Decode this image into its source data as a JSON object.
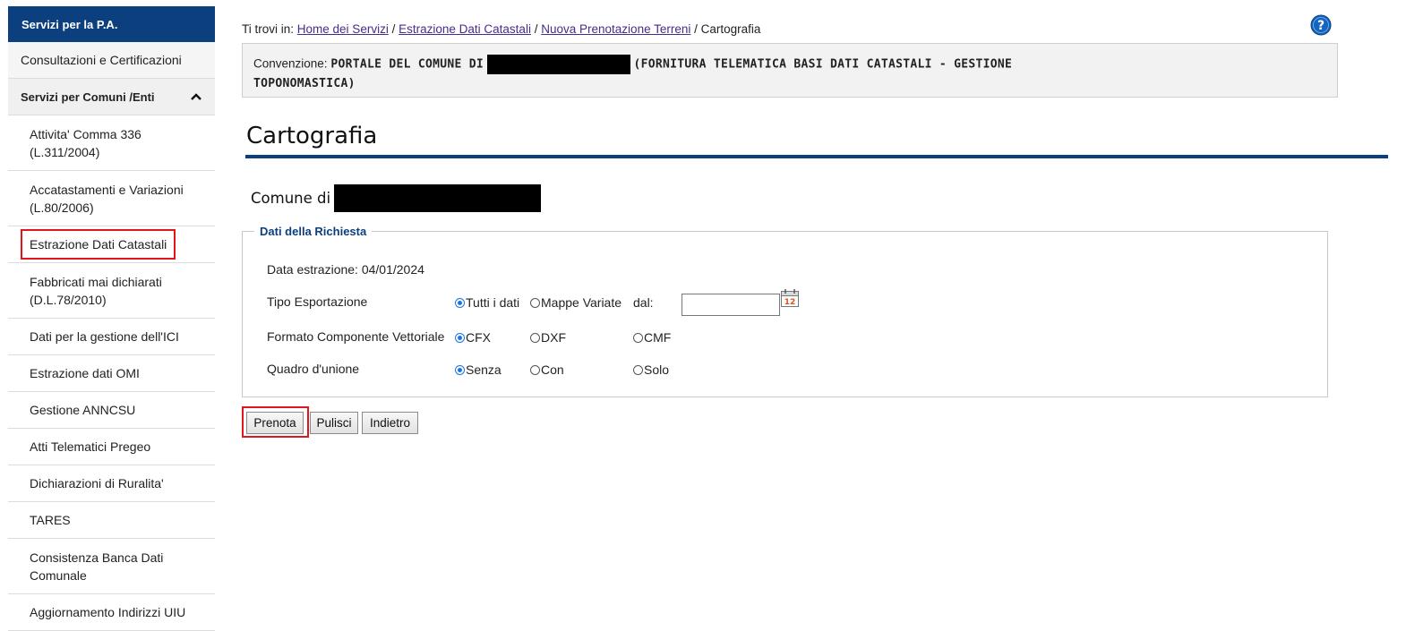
{
  "sidebar": {
    "header": "Servizi per la P.A.",
    "level1_consultazioni": "Consultazioni e Certificazioni",
    "level1_comuni": "Servizi per Comuni /Enti",
    "items": [
      {
        "line1": "Attivita' Comma 336",
        "line2": "(L.311/2004)"
      },
      {
        "line1": "Accatastamenti e Variazioni",
        "line2": "(L.80/2006)"
      },
      {
        "line1": "Estrazione Dati Catastali",
        "line2": ""
      },
      {
        "line1": "Fabbricati mai dichiarati",
        "line2": "(D.L.78/2010)"
      },
      {
        "line1": "Dati per la gestione dell'ICI",
        "line2": ""
      },
      {
        "line1": "Estrazione dati OMI",
        "line2": ""
      },
      {
        "line1": "Gestione ANNCSU",
        "line2": ""
      },
      {
        "line1": "Atti Telematici Pregeo",
        "line2": ""
      },
      {
        "line1": "Dichiarazioni di Ruralita'",
        "line2": ""
      },
      {
        "line1": "TARES",
        "line2": ""
      },
      {
        "line1": "Consistenza Banca Dati",
        "line2": "Comunale"
      },
      {
        "line1": "Aggiornamento Indirizzi UIU",
        "line2": ""
      }
    ]
  },
  "breadcrumb": {
    "prefix": "Ti trovi in:",
    "links": [
      "Home dei Servizi",
      "Estrazione Dati Catastali",
      "Nuova Prenotazione Terreni"
    ],
    "separator": "/",
    "current": "Cartografia"
  },
  "convenzione": {
    "label": "Convenzione:",
    "part1": "PORTALE DEL COMUNE DI",
    "part2": "(FORNITURA TELEMATICA BASI DATI CATASTALI - GESTIONE",
    "part3": "TOPONOMASTICA)"
  },
  "page_title": "Cartografia",
  "comune_label": "Comune di",
  "form": {
    "legend": "Dati della Richiesta",
    "data_estrazione": "Data estrazione: 04/01/2024",
    "tipo_label": "Tipo Esportazione",
    "tipo_opt1": "Tutti i dati",
    "tipo_opt2": "Mappe Variate",
    "dal_label": "dal:",
    "formato_label": "Formato Componente Vettoriale",
    "formato_opt1": "CFX",
    "formato_opt2": "DXF",
    "formato_opt3": "CMF",
    "quadro_label": "Quadro d'unione",
    "quadro_opt1": "Senza",
    "quadro_opt2": "Con",
    "quadro_opt3": "Solo"
  },
  "buttons": {
    "prenota": "Prenota",
    "pulisci": "Pulisci",
    "indietro": "Indietro"
  },
  "colors": {
    "brand": "#0b3f7e",
    "highlight": "#e0161d"
  }
}
